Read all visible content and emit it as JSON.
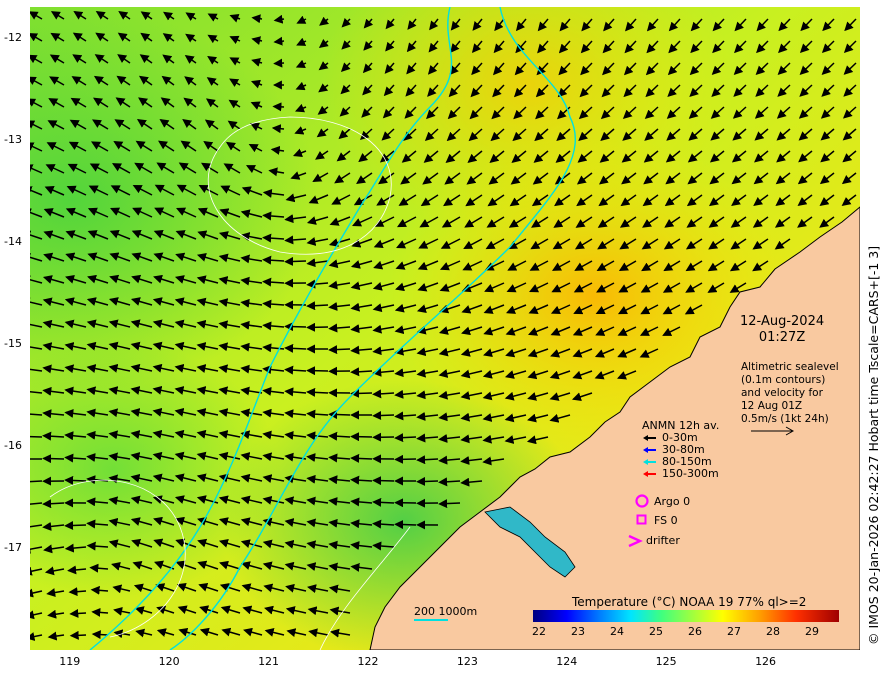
{
  "map": {
    "y_ticks": [
      {
        "label": "-12",
        "lat": -12
      },
      {
        "label": "-13",
        "lat": -13
      },
      {
        "label": "-14",
        "lat": -14
      },
      {
        "label": "-15",
        "lat": -15
      },
      {
        "label": "-16",
        "lat": -16
      },
      {
        "label": "-17",
        "lat": -17
      }
    ],
    "x_ticks": [
      {
        "label": "119",
        "lon": 119
      },
      {
        "label": "120",
        "lon": 120
      },
      {
        "label": "121",
        "lon": 121
      },
      {
        "label": "122",
        "lon": 122
      },
      {
        "label": "123",
        "lon": 123
      },
      {
        "label": "124",
        "lon": 124
      },
      {
        "label": "125",
        "lon": 125
      },
      {
        "label": "126",
        "lon": 126
      }
    ],
    "extent": {
      "lon_min": 118.6,
      "lon_max": 126.95,
      "lat_max": -11.7,
      "lat_min": -18.0
    },
    "colors": {
      "land": "#f9c9a0",
      "coastline": "#000000",
      "isobath": "#00e0e0",
      "contour": "#ffffff",
      "arrow": "#000000"
    }
  },
  "date": {
    "day": "12-Aug-2024",
    "time": "01:27Z"
  },
  "info": {
    "lines": [
      "Altimetric sealevel",
      "(0.1m contours)",
      "and velocity for",
      "12 Aug 01Z",
      "0.5m/s (1kt 24h)"
    ]
  },
  "anmn": {
    "title": "ANMN 12h av.",
    "items": [
      {
        "label": "0-30m",
        "color": "#000000"
      },
      {
        "label": "30-80m",
        "color": "#0000ff"
      },
      {
        "label": "80-150m",
        "color": "#00e0e0"
      },
      {
        "label": "150-300m",
        "color": "#ff0000"
      }
    ]
  },
  "markers": {
    "argo": "Argo 0",
    "fs": "FS 0",
    "drifter": "drifter",
    "color": "#ff00ff"
  },
  "colorbar": {
    "title": "Temperature (°C) NOAA 19 77% ql>=2",
    "ticks": [
      "22",
      "23",
      "24",
      "25",
      "26",
      "27",
      "28",
      "29"
    ]
  },
  "isobath_legend": {
    "label": "200  1000m"
  },
  "credit": "© IMOS 20-Jan-2026 02:42:27 Hobart time Tscale=CARS+[-1 3]"
}
